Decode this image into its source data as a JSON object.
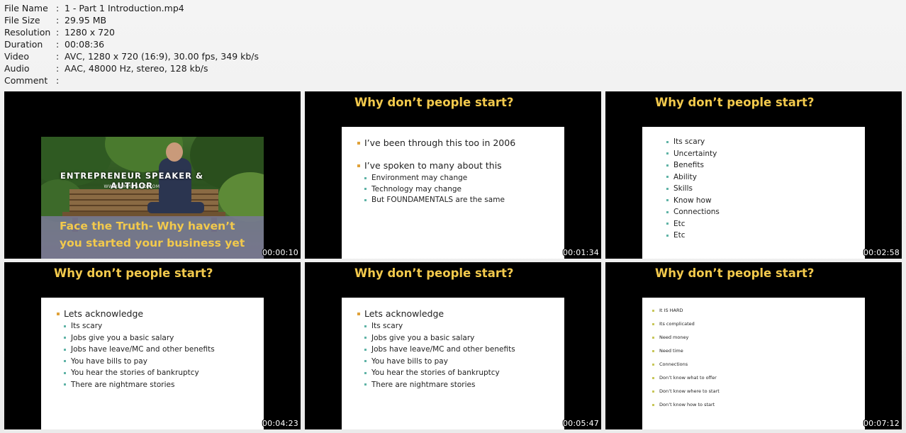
{
  "info": [
    {
      "key": "File Name",
      "value": "1 - Part 1 Introduction.mp4"
    },
    {
      "key": "File Size",
      "value": "29.95 MB"
    },
    {
      "key": "Resolution",
      "value": "1280 x 720"
    },
    {
      "key": "Duration",
      "value": "00:08:36"
    },
    {
      "key": "Video",
      "value": "AVC, 1280 x 720 (16:9), 30.00 fps, 349 kb/s"
    },
    {
      "key": "Audio",
      "value": "AAC, 48000 Hz, stereo, 128 kb/s"
    },
    {
      "key": "Comment",
      "value": ""
    }
  ],
  "separator": ":",
  "thumbs": [
    {
      "timestamp": "00:00:10",
      "banner": "ENTREPRENEUR SPEAKER & AUTHOR",
      "url": "WWW.SIMPLYSAID.COM",
      "caption_line1": "Face the Truth- Why haven’t",
      "caption_line2": "you started your business yet"
    },
    {
      "timestamp": "00:01:34",
      "title": "Why don’t people start?",
      "bullets": [
        {
          "text": "I’ve been through this too in 2006"
        },
        {
          "text": "I’ve spoken to many about this",
          "sub": [
            "Environment may change",
            "Technology may change",
            "But FOUNDAMENTALS are the same"
          ]
        }
      ]
    },
    {
      "timestamp": "00:02:58",
      "title": "Why don’t people start?",
      "items": [
        "Its scary",
        "Uncertainty",
        "Benefits",
        "Ability",
        "Skills",
        "Know how",
        "Connections",
        "Etc",
        "Etc"
      ]
    },
    {
      "timestamp": "00:04:23",
      "title": "Why don’t people start?",
      "heading": "Lets acknowledge",
      "items": [
        "Its scary",
        "Jobs give you a basic salary",
        "Jobs have leave/MC and other benefits",
        "You have bills to pay",
        "You hear the stories of bankruptcy",
        "There are nightmare stories"
      ]
    },
    {
      "timestamp": "00:05:47",
      "title": "Why don’t people start?",
      "heading": "Lets acknowledge",
      "items": [
        "Its scary",
        "Jobs give you a basic salary",
        "Jobs have leave/MC and other benefits",
        "You have bills to pay",
        "You hear the stories of bankruptcy",
        "There are nightmare stories"
      ]
    },
    {
      "timestamp": "00:07:12",
      "title": "Why don’t people start?",
      "items": [
        "It IS HARD",
        "Its complicated",
        "Need money",
        "Need time",
        "Connections",
        "Don’t know what to offer",
        "Don’t know where to start",
        "Don’t know how to start"
      ]
    }
  ]
}
